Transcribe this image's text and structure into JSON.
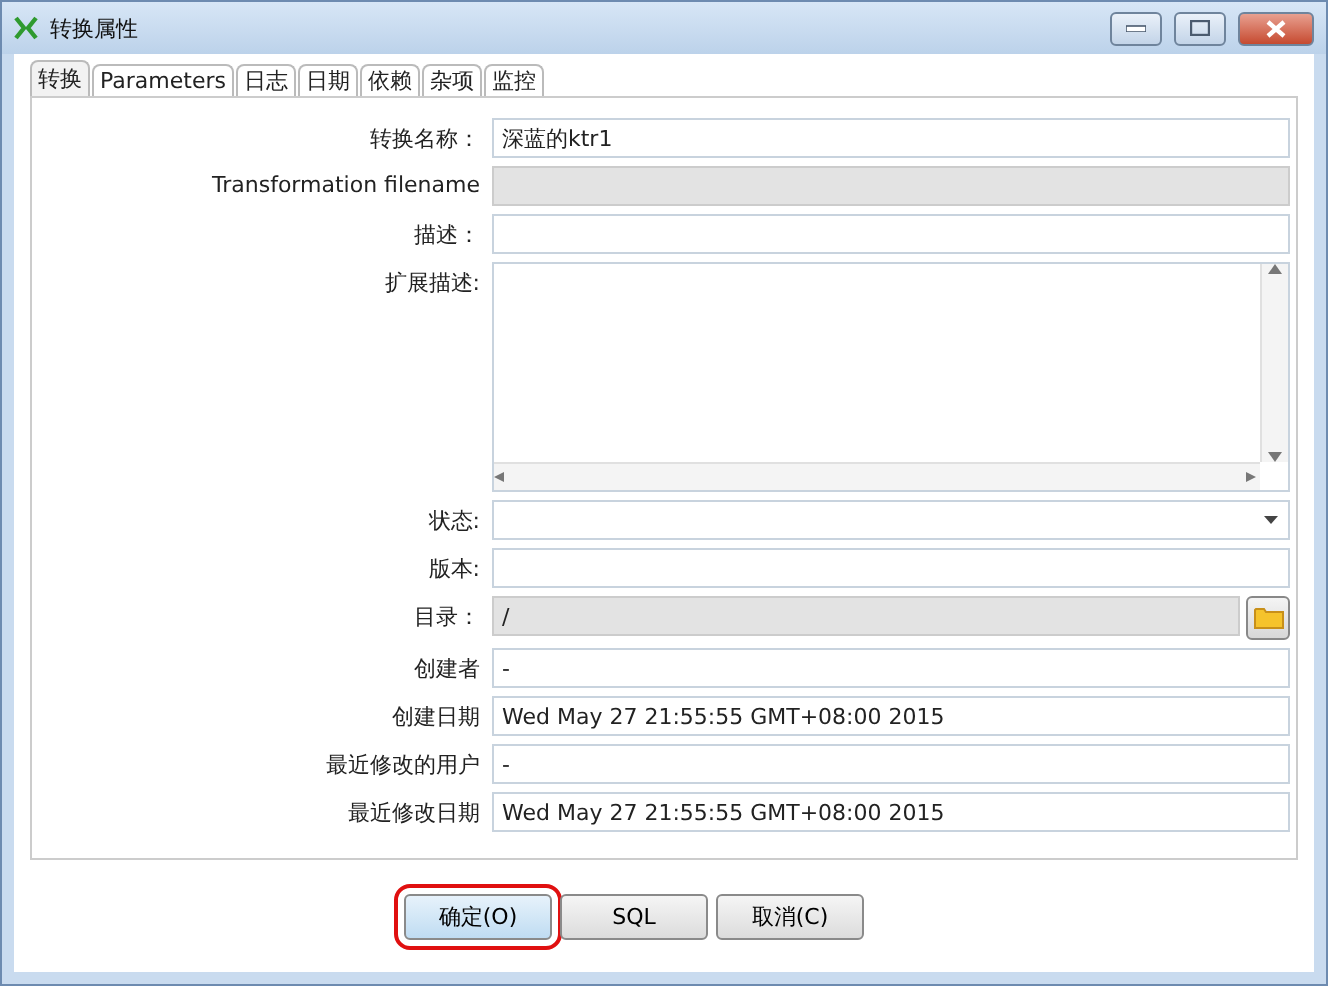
{
  "window": {
    "title": "转换属性"
  },
  "tabs": [
    {
      "label": "转换",
      "selected": true
    },
    {
      "label": "Parameters",
      "selected": false
    },
    {
      "label": "日志",
      "selected": false
    },
    {
      "label": "日期",
      "selected": false
    },
    {
      "label": "依赖",
      "selected": false
    },
    {
      "label": "杂项",
      "selected": false
    },
    {
      "label": "监控",
      "selected": false
    }
  ],
  "fields": [
    {
      "kind": "text",
      "label": "转换名称：",
      "value": "深蓝的ktr1",
      "disabled": false
    },
    {
      "kind": "text",
      "label": "Transformation filename",
      "disabled": true
    },
    {
      "kind": "text",
      "label": "描述：",
      "disabled": false
    },
    {
      "kind": "textarea",
      "label": "扩展描述:",
      "disabled": false
    },
    {
      "kind": "select",
      "label": "状态:",
      "disabled": false
    },
    {
      "kind": "text",
      "label": "版本:",
      "disabled": false
    },
    {
      "kind": "folder",
      "label": "目录：",
      "value": "/",
      "disabled": true
    },
    {
      "kind": "text",
      "label": "创建者",
      "value": "-",
      "disabled": false
    },
    {
      "kind": "text",
      "label": "创建日期",
      "value": "Wed May 27 21:55:55 GMT+08:00 2015",
      "disabled": false
    },
    {
      "kind": "text",
      "label": "最近修改的用户",
      "value": "-",
      "disabled": false
    },
    {
      "kind": "text",
      "label": "最近修改日期",
      "value": "Wed May 27 21:55:55 GMT+08:00 2015",
      "disabled": false
    }
  ],
  "buttons": [
    {
      "label": "确定(O)",
      "highlighted": true
    },
    {
      "label": "SQL",
      "highlighted": false
    },
    {
      "label": "取消(C)",
      "highlighted": false
    }
  ]
}
